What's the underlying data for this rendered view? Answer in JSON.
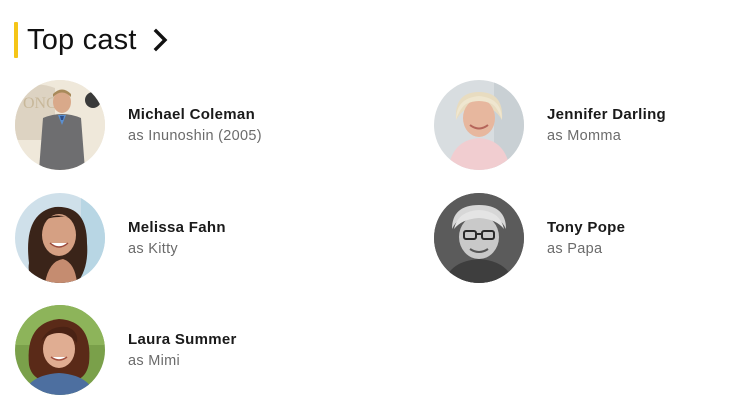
{
  "section": {
    "title": "Top cast",
    "accent_color": "#f5c518",
    "chevron_icon": "chevron-right-icon"
  },
  "cast": [
    {
      "name": "Michael Coleman",
      "as_prefix": "as",
      "character": "Inunoshin (2005)"
    },
    {
      "name": "Jennifer Darling",
      "as_prefix": "as",
      "character": "Momma"
    },
    {
      "name": "Melissa Fahn",
      "as_prefix": "as",
      "character": "Kitty"
    },
    {
      "name": "Tony Pope",
      "as_prefix": "as",
      "character": "Papa"
    },
    {
      "name": "Laura Summer",
      "as_prefix": "as",
      "character": "Mimi"
    }
  ]
}
